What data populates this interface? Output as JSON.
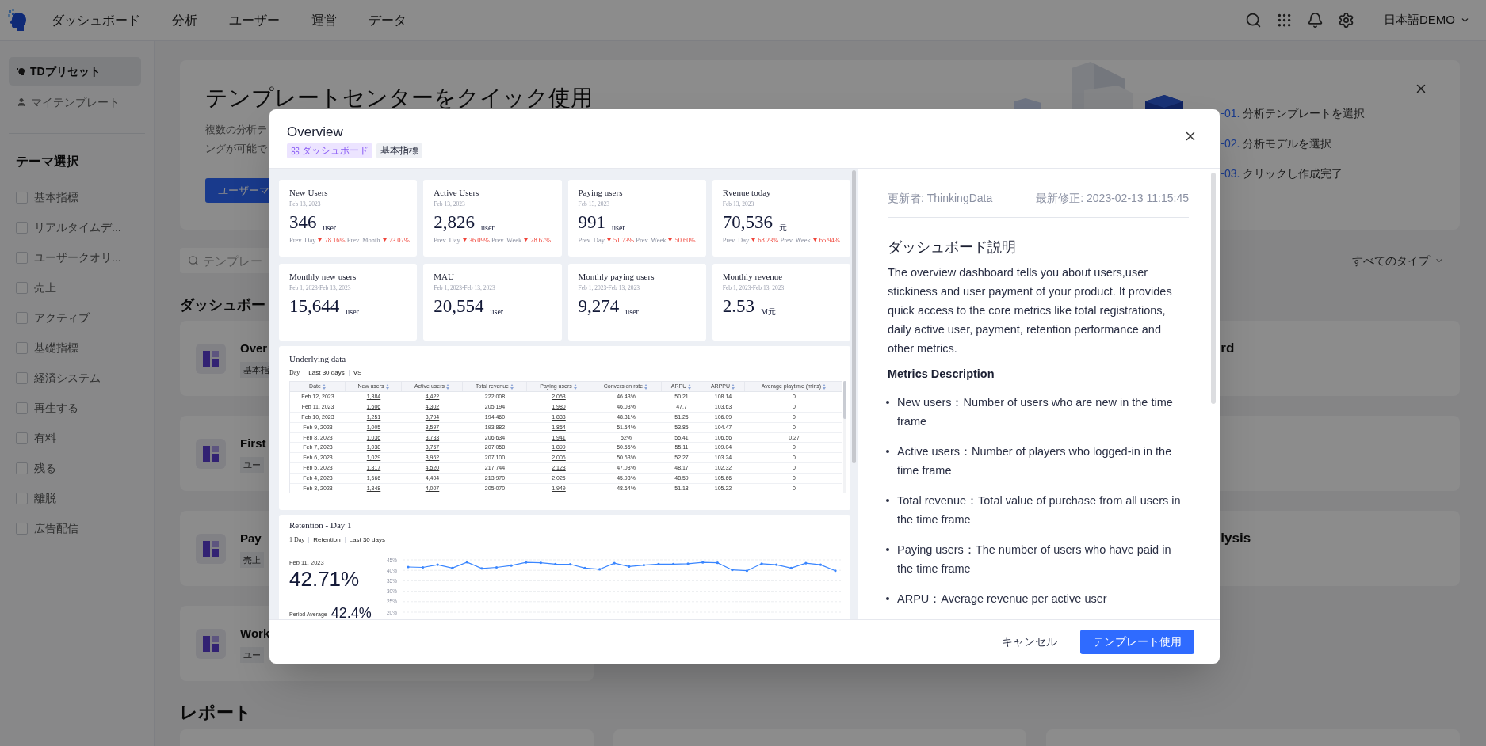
{
  "top_nav": {
    "items": [
      "ダッシュボード",
      "分析",
      "ユーザー",
      "運営",
      "データ"
    ],
    "user": "日本語DEMO"
  },
  "sidebar": {
    "items": [
      {
        "label": "TDプリセット",
        "kind": "preset",
        "selected": true
      },
      {
        "label": "マイテンプレート",
        "kind": "personal",
        "selected": false
      }
    ],
    "theme_title": "テーマ選択",
    "themes": [
      {
        "label": "基本指標",
        "checked": false
      },
      {
        "label": "リアルタイムデ...",
        "checked": false
      },
      {
        "label": "ユーザークオリ...",
        "checked": false
      },
      {
        "label": "売上",
        "checked": false
      },
      {
        "label": "アクティブ",
        "checked": false
      },
      {
        "label": "基礎指標",
        "checked": false
      },
      {
        "label": "経済システム",
        "checked": false
      },
      {
        "label": "再生する",
        "checked": false
      },
      {
        "label": "有料",
        "checked": false
      },
      {
        "label": "残る",
        "checked": false
      },
      {
        "label": "離脱",
        "checked": false
      },
      {
        "label": "広告配信",
        "checked": false
      }
    ]
  },
  "banner": {
    "title": "テンプレートセンターをクイック使用",
    "description": [
      "複数の分析テ",
      "ングが可能で"
    ],
    "button": "ユーザーマ",
    "steps": [
      {
        "number": "01.",
        "label": "分析テンプレートを選択"
      },
      {
        "number": "02.",
        "label": "分析モデルを選択"
      },
      {
        "number": "03.",
        "label": "クリックし作成完了"
      }
    ]
  },
  "search": {
    "placeholder": "テンプレー"
  },
  "type_filter": "すべてのタイプ",
  "dashboards": {
    "heading": "ダッシュボー",
    "rows": [
      {
        "title": "Over",
        "tag": "基本指",
        "right_card": true,
        "right_title": "rd"
      },
      {
        "title": "First",
        "tag": "ユー",
        "right_card": true
      },
      {
        "title": "Pay",
        "tag": "売上",
        "right_card": true,
        "right_title": "lysis"
      },
      {
        "title": "Work",
        "tag": "ユー",
        "right_card": false
      }
    ]
  },
  "reports_heading": "レポート",
  "modal": {
    "title": "Overview",
    "tags": [
      {
        "label": "ダッシュボード",
        "kind": "dashboard"
      },
      {
        "label": "基本指標",
        "kind": "plain"
      }
    ],
    "preview": {
      "kpis": [
        {
          "title": "New Users",
          "date": "Feb 13, 2023",
          "value": "346",
          "unit": "user",
          "comparisons": [
            {
              "label": "Prev. Day",
              "change": "78.16%",
              "down": true
            },
            {
              "label": "Prev. Month",
              "change": "73.07%",
              "down": true
            }
          ]
        },
        {
          "title": "Active Users",
          "date": "Feb 13, 2023",
          "value": "2,826",
          "unit": "user",
          "comparisons": [
            {
              "label": "Prev. Day",
              "change": "36.09%",
              "down": true
            },
            {
              "label": "Prev. Week",
              "change": "28.67%",
              "down": true
            }
          ]
        },
        {
          "title": "Paying users",
          "date": "Feb 13, 2023",
          "value": "991",
          "unit": "user",
          "comparisons": [
            {
              "label": "Prev. Day",
              "change": "51.73%",
              "down": true
            },
            {
              "label": "Prev. Week",
              "change": "50.60%",
              "down": true
            }
          ]
        },
        {
          "title": "Rvenue today",
          "date": "Feb 13, 2023",
          "value": "70,536",
          "unit": "元",
          "comparisons": [
            {
              "label": "Prev. Day",
              "change": "68.23%",
              "down": true
            },
            {
              "label": "Prev. Week",
              "change": "65.94%",
              "down": true
            }
          ]
        },
        {
          "title": "Monthly new users",
          "date": "Feb 1, 2023-Feb 13, 2023",
          "value": "15,644",
          "unit": "user"
        },
        {
          "title": "MAU",
          "date": "Feb 1, 2023-Feb 13, 2023",
          "value": "20,554",
          "unit": "user"
        },
        {
          "title": "Monthly paying users",
          "date": "Feb 1, 2023-Feb 13, 2023",
          "value": "9,274",
          "unit": "user"
        },
        {
          "title": "Monthly revenue",
          "date": "Feb 1, 2023-Feb 13, 2023",
          "value": "2.53",
          "unit": "M元"
        }
      ],
      "table": {
        "title": "Underlying data",
        "filters": [
          "Day",
          "Last 30 days",
          "VS"
        ],
        "columns": [
          {
            "label": "Date",
            "link": false
          },
          {
            "label": "New users",
            "link": true
          },
          {
            "label": "Active users",
            "link": true
          },
          {
            "label": "Total revenue",
            "link": false
          },
          {
            "label": "Paying users",
            "link": true
          },
          {
            "label": "Conversion rate",
            "link": false
          },
          {
            "label": "ARPU",
            "link": false
          },
          {
            "label": "ARPPU",
            "link": false
          },
          {
            "label": "Average playtime (mins)",
            "link": false
          }
        ],
        "rows": [
          [
            "Feb 12, 2023",
            "1,384",
            "4,422",
            "222,008",
            "2,053",
            "46.43%",
            "50.21",
            "108.14",
            "0"
          ],
          [
            "Feb 11, 2023",
            "1,606",
            "4,302",
            "205,194",
            "1,980",
            "46.03%",
            "47.7",
            "103.63",
            "0"
          ],
          [
            "Feb 10, 2023",
            "1,251",
            "3,794",
            "194,460",
            "1,833",
            "48.31%",
            "51.25",
            "106.09",
            "0"
          ],
          [
            "Feb 9, 2023",
            "1,005",
            "3,597",
            "193,882",
            "1,854",
            "51.54%",
            "53.85",
            "104.47",
            "0"
          ],
          [
            "Feb 8, 2023",
            "1,036",
            "3,733",
            "206,634",
            "1,941",
            "52%",
            "55.41",
            "106.56",
            "0.27"
          ],
          [
            "Feb 7, 2023",
            "1,038",
            "3,757",
            "207,058",
            "1,899",
            "50.55%",
            "55.11",
            "109.04",
            "0"
          ],
          [
            "Feb 6, 2023",
            "1,029",
            "3,962",
            "207,100",
            "2,006",
            "50.63%",
            "52.27",
            "103.24",
            "0"
          ],
          [
            "Feb 5, 2023",
            "1,817",
            "4,520",
            "217,744",
            "2,128",
            "47.08%",
            "48.17",
            "102.32",
            "0"
          ],
          [
            "Feb 4, 2023",
            "1,666",
            "4,404",
            "213,970",
            "2,025",
            "45.98%",
            "48.59",
            "105.66",
            "0"
          ],
          [
            "Feb 3, 2023",
            "1,348",
            "4,007",
            "205,070",
            "1,949",
            "48.64%",
            "51.18",
            "105.22",
            "0"
          ]
        ]
      },
      "retention": {
        "title": "Retention - Day 1",
        "filters": [
          "1 Day",
          "Retention",
          "Last 30 days"
        ],
        "date": "Feb 11, 2023",
        "value": "42.71%",
        "average_label": "Period Average",
        "average": "42.4%",
        "chart_data": {
          "type": "line",
          "grid": true,
          "ylim": [
            20,
            45
          ],
          "yticks": [
            {
              "value": 45,
              "label": "45%"
            },
            {
              "value": 40,
              "label": "40%"
            },
            {
              "value": 35,
              "label": "35%"
            },
            {
              "value": 30,
              "label": "30%"
            },
            {
              "value": 25,
              "label": "25%"
            },
            {
              "value": 20,
              "label": "20%"
            }
          ],
          "series": [
            {
              "color": "#3a86ff",
              "values": [
                41.6,
                41.4,
                42.7,
                41.1,
                43.9,
                40.9,
                41.4,
                42.3,
                43.8,
                43.6,
                43.0,
                42.9,
                41.1,
                40.5,
                43.4,
                41.8,
                42.5,
                43.0,
                43.0,
                43.2,
                43.8,
                43.6,
                40.2,
                39.8,
                43.2,
                42.7,
                41.1,
                43.4,
                42.7,
                39.8
              ]
            }
          ]
        }
      }
    },
    "details": {
      "updated_by": "更新者: ThinkingData",
      "modified": "最新修正: 2023-02-13 11:15:45",
      "heading": "ダッシュボード説明",
      "description": "The overview dashboard tells you about users,user stickiness and user payment of your product. It provides quick access to the core metrics like total registrations, daily active user, payment, retention performance and other metrics.",
      "metrics_heading": "Metrics Description",
      "metrics": [
        "New users：Number of users who are new in the time frame",
        "Active users：Number of players who logged-in in the time frame",
        "Total revenue：Total value of purchase from all users in the time frame",
        "Paying users：The number of users who have paid in the time frame",
        "ARPU：Average revenue per active user"
      ]
    },
    "buttons": {
      "cancel": "キャンセル",
      "confirm": "テンプレート使用"
    }
  }
}
